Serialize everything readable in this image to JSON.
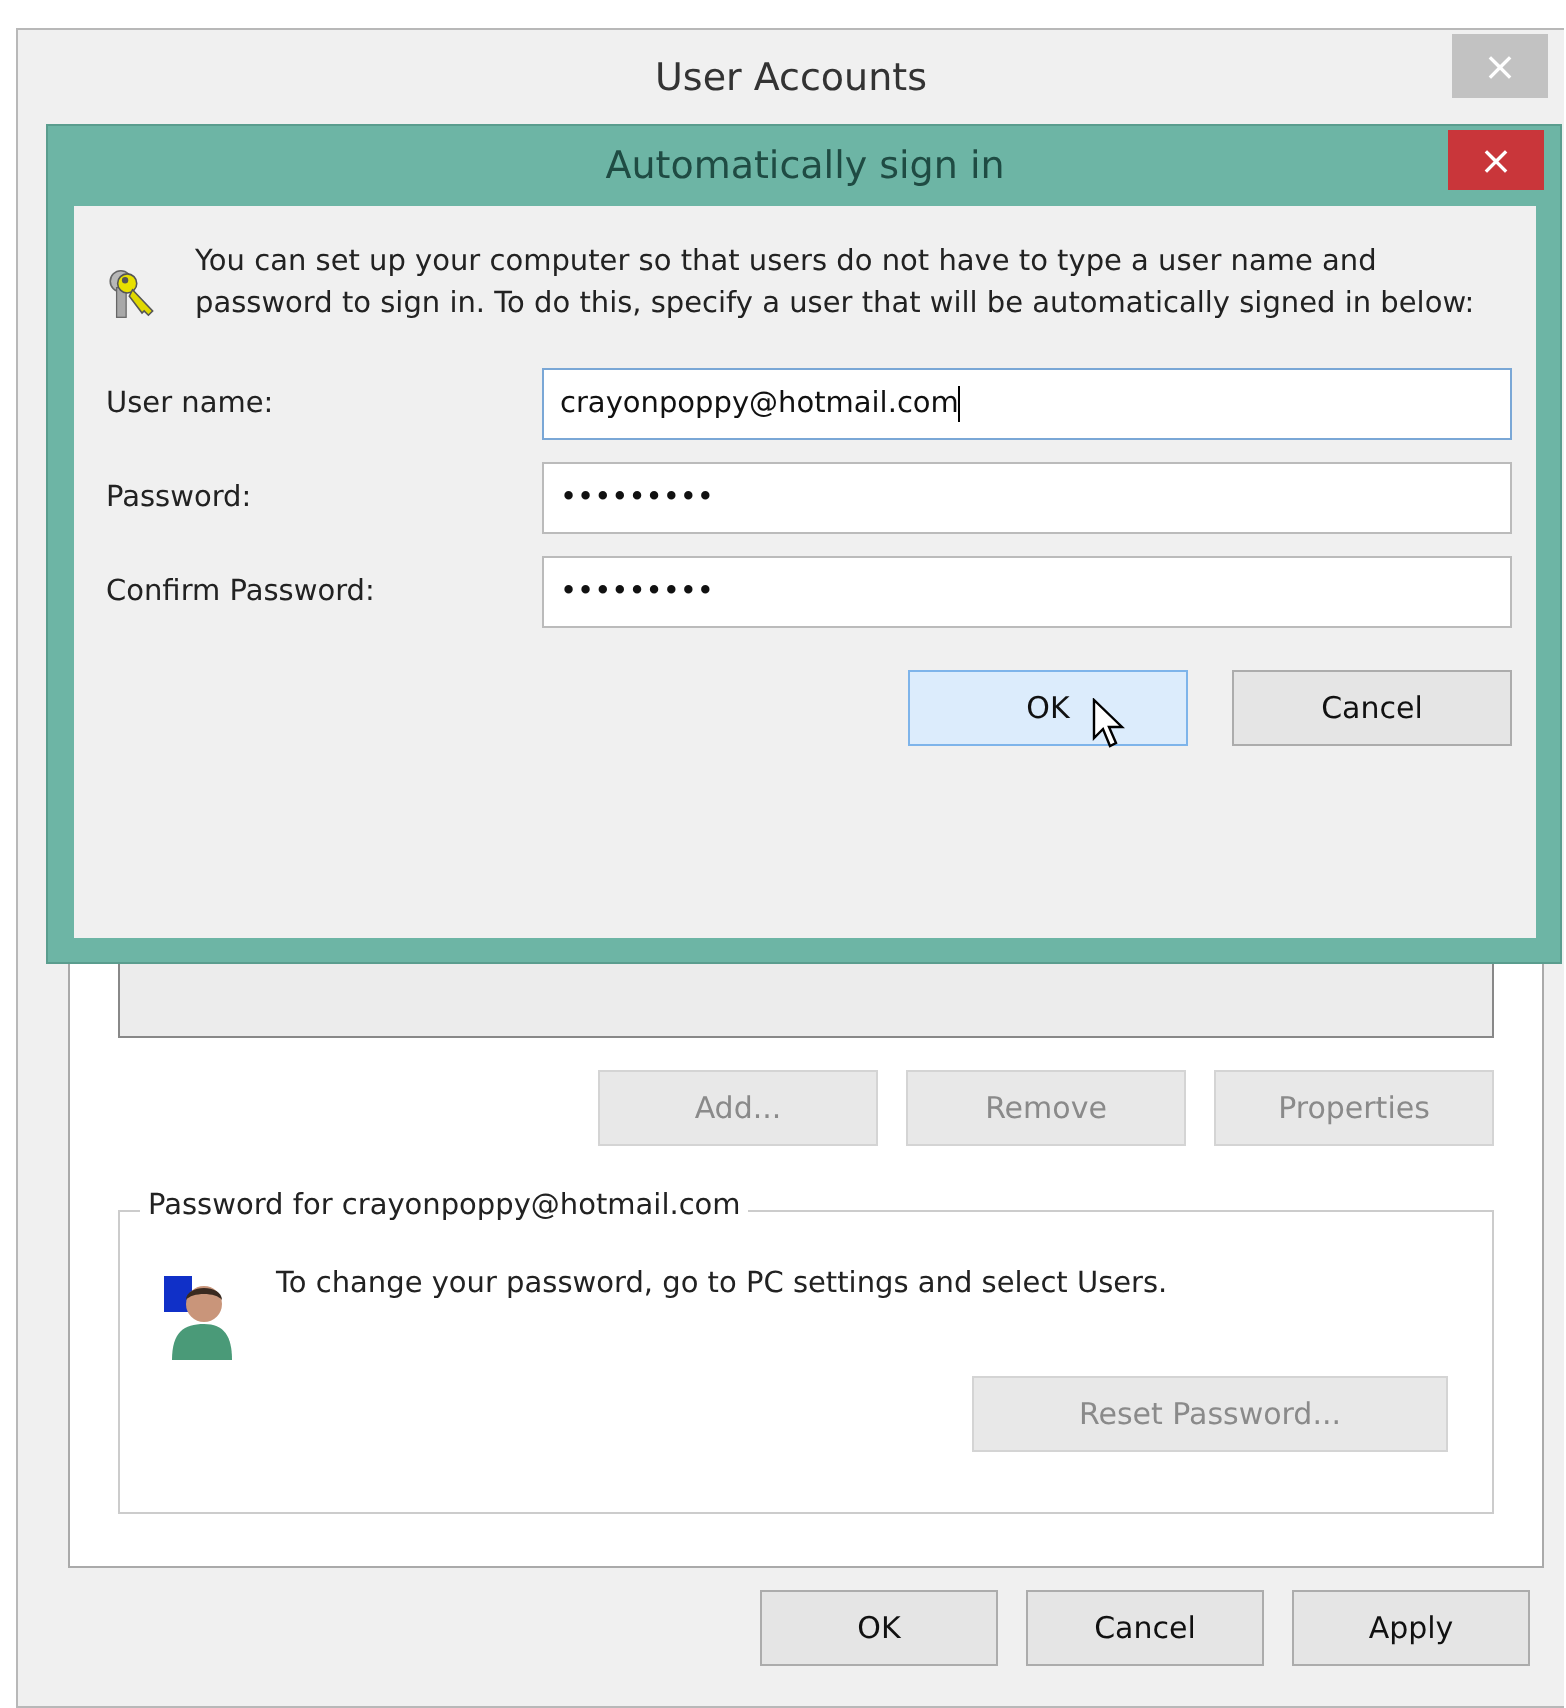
{
  "window": {
    "title": "User Accounts",
    "close_label": "×"
  },
  "list_buttons": [
    {
      "label": "Add...",
      "disabled": true
    },
    {
      "label": "Remove",
      "disabled": true
    },
    {
      "label": "Properties",
      "disabled": true
    }
  ],
  "password_group": {
    "title": "Password for crayonpoppy@hotmail.com",
    "message": "To change your password, go to PC settings and select Users.",
    "button": {
      "label": "Reset Password...",
      "disabled": true
    }
  },
  "buttons": [
    {
      "label": "OK",
      "disabled": false
    },
    {
      "label": "Cancel",
      "disabled": false
    },
    {
      "label": "Apply",
      "disabled": false
    }
  ],
  "dialog": {
    "title": "Automatically sign in",
    "close_label": "×",
    "description": "You can set up your computer so that users do not have to type a user name and password to sign in. To do this, specify a user that will be automatically signed in below:",
    "fields": [
      {
        "label": "User name:",
        "value": "crayonpoppy@hotmail.com",
        "focused": true
      },
      {
        "label": "Password:",
        "value": "•••••••••",
        "focused": false
      },
      {
        "label": "Confirm Password:",
        "value": "•••••••••",
        "focused": false
      }
    ],
    "buttons": [
      {
        "label": "OK",
        "hovered": true
      },
      {
        "label": "Cancel",
        "hovered": false
      }
    ]
  }
}
